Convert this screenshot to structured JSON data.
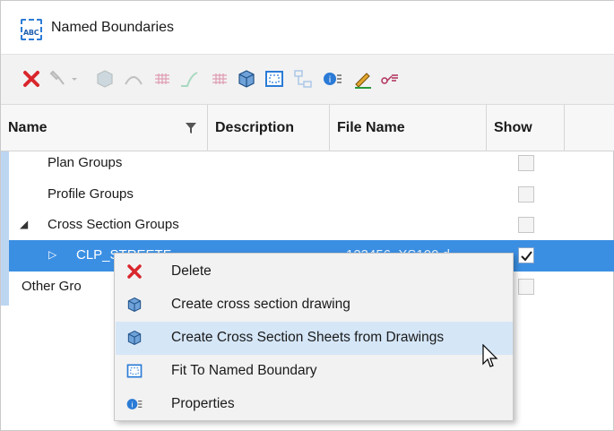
{
  "window": {
    "title": "Named Boundaries",
    "title_icon": "named-boundary-abc-icon"
  },
  "toolbar": {
    "buttons": [
      {
        "name": "delete-button",
        "icon": "red-x-icon",
        "enabled": true
      },
      {
        "name": "tool-dropdown-button",
        "icon": "wrench-icon",
        "enabled": false
      },
      {
        "name": "cross-section-tool-button",
        "icon": "cube-icon",
        "enabled": false
      },
      {
        "name": "profile-tool-button",
        "icon": "profile-arc-icon",
        "enabled": false
      },
      {
        "name": "grid-tool-button",
        "icon": "grid-icon",
        "enabled": false
      },
      {
        "name": "path-tool-button",
        "icon": "path-icon",
        "enabled": false
      },
      {
        "name": "sheet-tool-button",
        "icon": "sheet-icon",
        "enabled": false
      },
      {
        "name": "create-drawing-button",
        "icon": "cube-icon",
        "enabled": true
      },
      {
        "name": "fit-boundary-button",
        "icon": "fit-frame-icon",
        "enabled": true
      },
      {
        "name": "hierarchy-button",
        "icon": "hierarchy-icon",
        "enabled": false
      },
      {
        "name": "properties-button",
        "icon": "properties-icon",
        "enabled": true
      },
      {
        "name": "edit-pencil-button",
        "icon": "pencil-icon",
        "enabled": true
      },
      {
        "name": "key-settings-button",
        "icon": "key-icon",
        "enabled": true
      }
    ]
  },
  "columns": {
    "name": "Name",
    "description": "Description",
    "file_name": "File Name",
    "show": "Show"
  },
  "rows": [
    {
      "label": "Plan Groups",
      "expander": "",
      "file": "",
      "checked": false
    },
    {
      "label": "Profile Groups",
      "expander": "",
      "file": "",
      "checked": false
    },
    {
      "label": "Cross Section Groups",
      "expander": "◢",
      "file": "",
      "checked": false
    },
    {
      "label": "CLP_STREETF",
      "expander": "▷",
      "file": "123456_XS100.d",
      "checked": true
    },
    {
      "label": "Other Gro",
      "expander": "",
      "file": "",
      "checked": false
    }
  ],
  "context_menu": {
    "items": [
      {
        "label": "Delete",
        "icon": "red-x-icon"
      },
      {
        "label": "Create cross section drawing",
        "icon": "cube-icon"
      },
      {
        "label": "Create Cross Section Sheets from Drawings",
        "icon": "cube-icon",
        "hovered": true
      },
      {
        "label": "Fit To Named Boundary",
        "icon": "fit-frame-icon"
      },
      {
        "label": "Properties",
        "icon": "properties-icon"
      }
    ]
  },
  "colors": {
    "selection": "#3b8fe3",
    "menu_hover": "#d5e6f7",
    "accent_bar": "#bcd6f2",
    "delete_red": "#d9262c"
  }
}
